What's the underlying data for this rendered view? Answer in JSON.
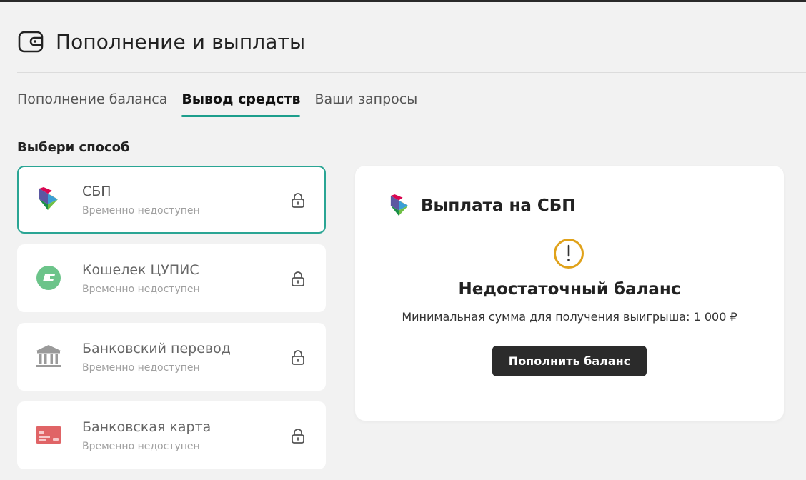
{
  "header": {
    "title": "Пополнение и выплаты",
    "icon": "wallet-icon"
  },
  "tabs": [
    {
      "label": "Пополнение баланса",
      "active": false
    },
    {
      "label": "Вывод средств",
      "active": true
    },
    {
      "label": "Ваши запросы",
      "active": false
    }
  ],
  "section_label": "Выбери способ",
  "methods": [
    {
      "title": "СБП",
      "subtitle": "Временно недоступен",
      "icon": "sbp-icon",
      "selected": true
    },
    {
      "title": "Кошелек ЦУПИС",
      "subtitle": "Временно недоступен",
      "icon": "cupis-wallet-icon",
      "selected": false
    },
    {
      "title": "Банковский перевод",
      "subtitle": "Временно недоступен",
      "icon": "bank-icon",
      "selected": false
    },
    {
      "title": "Банковская карта",
      "subtitle": "Временно недоступен",
      "icon": "bank-card-icon",
      "selected": false
    }
  ],
  "panel": {
    "title": "Выплата на СБП",
    "warning_title": "Недостаточный баланс",
    "warning_text": "Минимальная сумма для получения выигрыша: 1 000 ₽",
    "button_label": "Пополнить баланс"
  },
  "colors": {
    "accent": "#1d9e8c",
    "warning": "#e0a21a",
    "button_bg": "#2b2b2b",
    "page_bg": "#f2f2f2"
  }
}
